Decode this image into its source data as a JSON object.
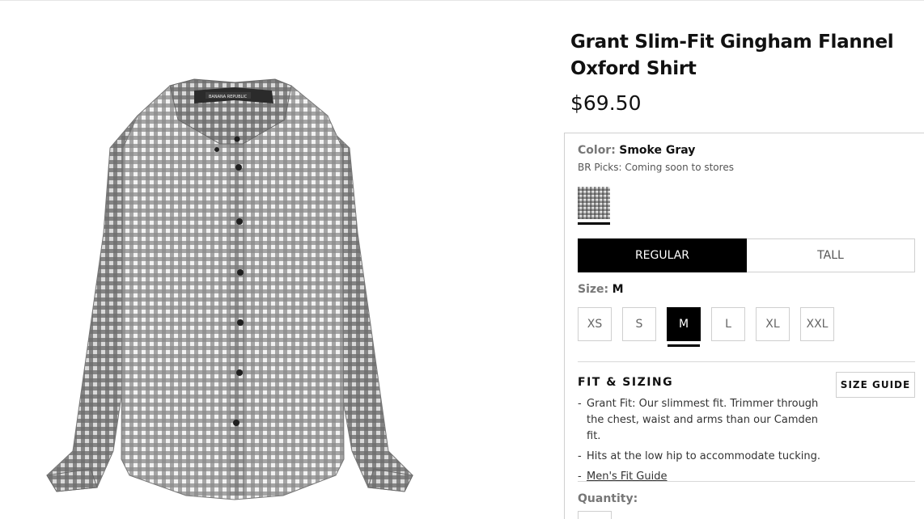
{
  "product": {
    "title": "Grant Slim-Fit Gingham Flannel Oxford Shirt",
    "price": "$69.50"
  },
  "color": {
    "label": "Color:",
    "value": "Smoke Gray",
    "note": "BR Picks: Coming soon to stores"
  },
  "fit_options": {
    "items": [
      {
        "label": "REGULAR",
        "selected": true
      },
      {
        "label": "TALL",
        "selected": false
      }
    ]
  },
  "size": {
    "label": "Size:",
    "value": "M",
    "options": [
      "XS",
      "S",
      "M",
      "L",
      "XL",
      "XXL"
    ],
    "selected": "M"
  },
  "fit_sizing": {
    "heading": "FIT & SIZING",
    "size_guide_label": "SIZE GUIDE",
    "bullets": [
      "Grant Fit: Our slimmest fit. Trimmer through the chest, waist and arms than our Camden fit.",
      "Hits at the low hip to accommodate tucking."
    ],
    "link_label": "Men's Fit Guide"
  },
  "quantity": {
    "label": "Quantity:"
  },
  "colors": {
    "selected_bg": "#000000",
    "border": "#cfcfcf",
    "muted_label": "#777777"
  }
}
